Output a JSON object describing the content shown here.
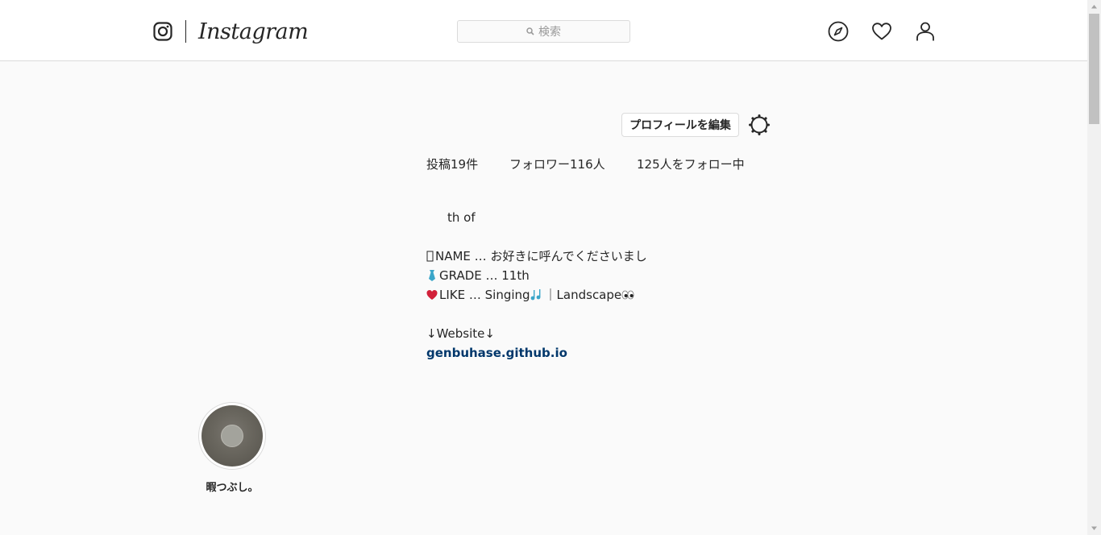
{
  "header": {
    "logo_text": "Instagram",
    "search_placeholder": "検索"
  },
  "profile": {
    "edit_button": "プロフィールを編集",
    "stats": {
      "posts": "投稿19件",
      "followers": "フォロワー116人",
      "following": "125人をフォロー中"
    },
    "bio": {
      "line1": "th of",
      "line2": "NAME … お好きに呼んでくださいまし",
      "line3": "GRADE … 11th",
      "line4": "LIKE … Singing",
      "line4b": "｜Landscape",
      "line5": "↓Website↓",
      "link": "genbuhase.github.io"
    }
  },
  "highlights": [
    {
      "label": "暇つぶし。"
    }
  ],
  "colors": {
    "link": "#00376b",
    "border": "#dbdbdb",
    "background": "#fafafa"
  }
}
